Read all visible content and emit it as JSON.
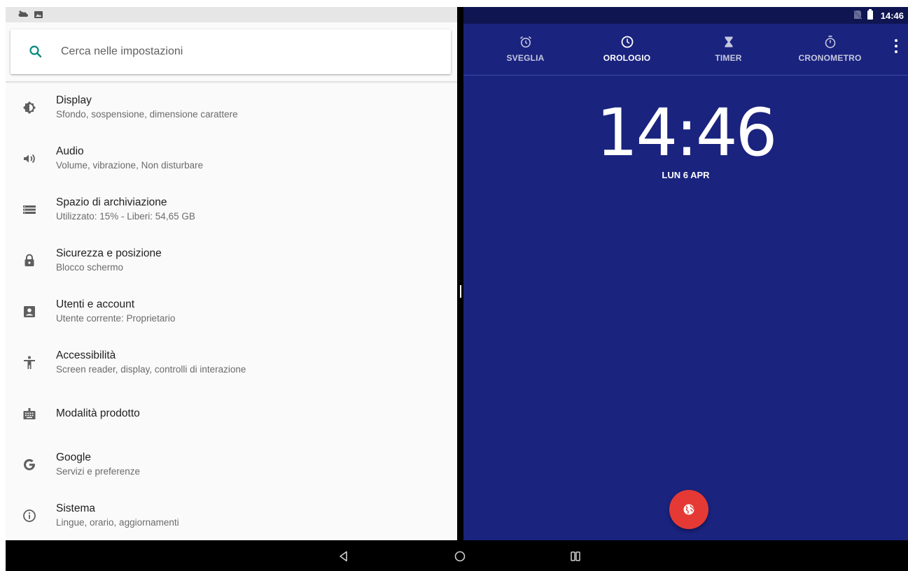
{
  "left_status": {
    "icons": [
      "weather-icon",
      "image-icon"
    ]
  },
  "search": {
    "placeholder": "Cerca nelle impostazioni"
  },
  "settings": {
    "items": [
      {
        "icon": "brightness-icon",
        "title": "Display",
        "subtitle": "Sfondo, sospensione, dimensione carattere"
      },
      {
        "icon": "volume-icon",
        "title": "Audio",
        "subtitle": "Volume, vibrazione, Non disturbare"
      },
      {
        "icon": "storage-icon",
        "title": "Spazio di archiviazione",
        "subtitle": "Utilizzato: 15% - Liberi: 54,65 GB"
      },
      {
        "icon": "lock-icon",
        "title": "Sicurezza e posizione",
        "subtitle": "Blocco schermo"
      },
      {
        "icon": "account-box-icon",
        "title": "Utenti e account",
        "subtitle": "Utente corrente: Proprietario"
      },
      {
        "icon": "accessibility-icon",
        "title": "Accessibilità",
        "subtitle": "Screen reader, display, controlli di interazione"
      },
      {
        "icon": "store-demo-icon",
        "title": "Modalità prodotto",
        "subtitle": ""
      },
      {
        "icon": "google-icon",
        "title": "Google",
        "subtitle": "Servizi e preferenze"
      },
      {
        "icon": "info-icon",
        "title": "Sistema",
        "subtitle": "Lingue, orario, aggiornamenti"
      }
    ]
  },
  "right_status": {
    "time": "14:46",
    "icons": [
      "no-sim-icon",
      "battery-icon"
    ]
  },
  "clock_tabs": [
    {
      "icon": "alarm-icon",
      "label": "SVEGLIA",
      "active": false
    },
    {
      "icon": "clock-icon",
      "label": "OROLOGIO",
      "active": true
    },
    {
      "icon": "hourglass-icon",
      "label": "TIMER",
      "active": false
    },
    {
      "icon": "stopwatch-icon",
      "label": "CRONOMETRO",
      "active": false
    }
  ],
  "clock": {
    "time": "14:46",
    "date": "LUN 6 APR"
  },
  "fab": {
    "icon": "globe-icon"
  },
  "colors": {
    "clock_bg": "#1a237e",
    "fab": "#e53935",
    "settings_bg": "#fafafa",
    "accent_search": "#009688"
  },
  "navbar": {
    "buttons": [
      "back-icon",
      "home-icon",
      "recents-icon"
    ]
  }
}
